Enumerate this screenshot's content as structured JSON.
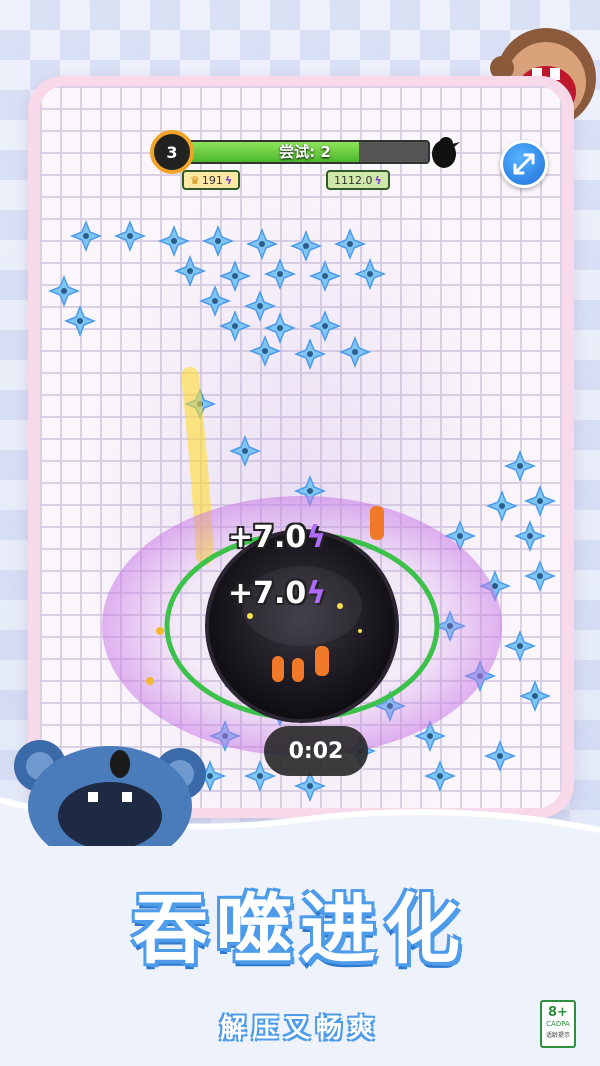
{
  "hud": {
    "level": "3",
    "attempt_label": "尝试: 2",
    "progress": 0.72,
    "best_score": "191",
    "current_score": "1112.0"
  },
  "popups": [
    "+7.0",
    "+7.0"
  ],
  "timer": "0:02",
  "banner": {
    "title": "吞噬进化",
    "subtitle": "解压又畅爽"
  },
  "age_rating": {
    "label": "8+",
    "org": "CADPA",
    "caption": "适龄提示"
  },
  "colors": {
    "accent_blue": "#4d9be9",
    "progress_green": "#6ccf44",
    "star_blue": "#7fc7f2",
    "hole_black": "#1a1a1f"
  },
  "icons": [
    "crown-icon",
    "lightning-icon",
    "bird-icon",
    "resize-arrows-icon",
    "ninja-star-icon",
    "koala-mascot",
    "monkey-mascot"
  ]
}
